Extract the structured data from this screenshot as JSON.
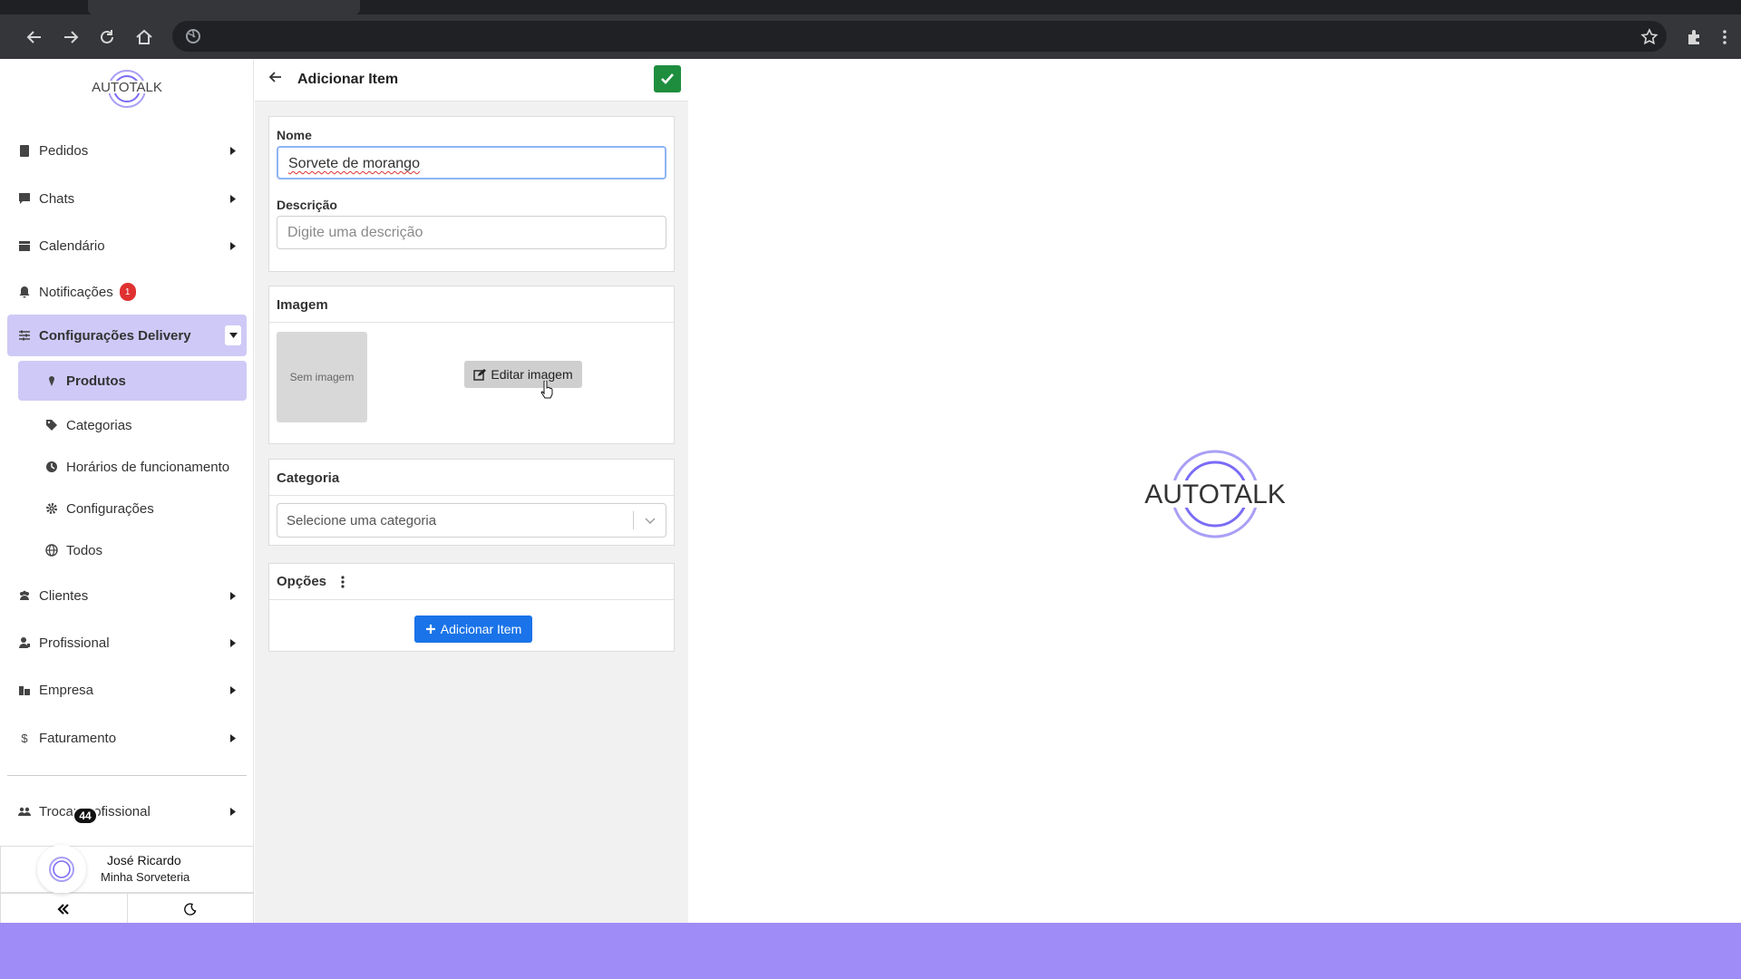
{
  "browser": {
    "back_icon": "arrow-left-icon",
    "forward_icon": "arrow-right-icon",
    "reload_icon": "reload-icon",
    "home_icon": "home-icon",
    "star_icon": "star-icon",
    "extensions_icon": "puzzle-icon",
    "menu_icon": "kebab-icon"
  },
  "brand": {
    "logo_text": "AUTOTALK",
    "accent": "#7b6cf6",
    "highlight": "#cfc9f7"
  },
  "sidebar": {
    "items": [
      {
        "label": "Pedidos",
        "icon": "clipboard-icon"
      },
      {
        "label": "Chats",
        "icon": "comment-icon"
      },
      {
        "label": "Calendário",
        "icon": "calendar-icon"
      },
      {
        "label": "Notificações",
        "icon": "bell-icon",
        "badge": "1"
      },
      {
        "label": "Configurações Delivery",
        "icon": "sliders-icon"
      },
      {
        "label": "Clientes",
        "icon": "users-icon"
      },
      {
        "label": "Profissional",
        "icon": "user-tie-icon"
      },
      {
        "label": "Empresa",
        "icon": "building-icon"
      },
      {
        "label": "Faturamento",
        "icon": "dollar-icon"
      },
      {
        "label": "Trocar profissional",
        "icon": "users-swap-icon"
      }
    ],
    "subitems": [
      {
        "label": "Produtos",
        "icon": "ice-cream-icon"
      },
      {
        "label": "Categorias",
        "icon": "tag-icon"
      },
      {
        "label": "Horários de funcionamento",
        "icon": "clock-icon"
      },
      {
        "label": "Configurações",
        "icon": "gear-icon"
      },
      {
        "label": "Todos",
        "icon": "globe-icon"
      }
    ],
    "user": {
      "name": "José Ricardo",
      "company": "Minha Sorveteria",
      "count": "44"
    },
    "collapse_icon": "double-chevron-left-icon",
    "theme_icon": "moon-icon"
  },
  "form": {
    "title": "Adicionar Item",
    "name_label": "Nome",
    "name_value": "Sorvete de morango",
    "description_label": "Descrição",
    "description_placeholder": "Digite uma descrição",
    "image_section": "Imagem",
    "no_image": "Sem imagem",
    "edit_image": "Editar imagem",
    "category_section": "Categoria",
    "category_placeholder": "Selecione uma categoria",
    "options_section": "Opções",
    "add_item": "Adicionar Item"
  },
  "preview": {
    "logo_text": "AUTOTALK"
  }
}
